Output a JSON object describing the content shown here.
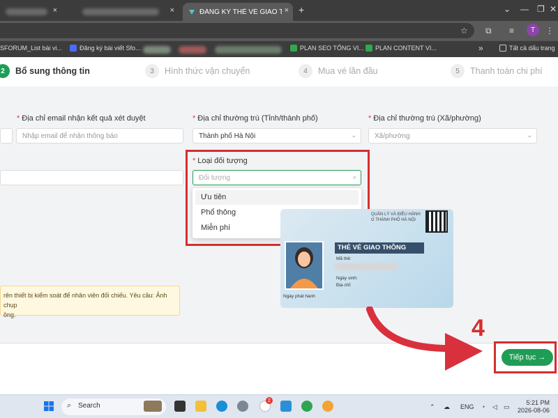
{
  "browser": {
    "active_tab_title": "ĐĂNG KÝ THẺ VÉ GIAO THÔNG",
    "tab_close": "×",
    "new_tab": "+",
    "bookmarks": [
      "SFORUM_List bài vi...",
      "Đăng ký bài viết Sfo...",
      "PLAN SEO TỔNG VI...",
      "PLAN CONTENT VI..."
    ],
    "bookmarks_overflow": "»",
    "all_bookmarks": "Tất cả dấu trang",
    "profile_initial": "T"
  },
  "steps": [
    {
      "num": "2",
      "label": "Bổ sung thông tin"
    },
    {
      "num": "3",
      "label": "Hình thức vận chuyển"
    },
    {
      "num": "4",
      "label": "Mua vé lần đầu"
    },
    {
      "num": "5",
      "label": "Thanh toán chi phí"
    }
  ],
  "form": {
    "email_label": "Địa chỉ email nhận kết quả xét duyệt",
    "email_placeholder": "Nhập email để nhận thông báo",
    "province_label": "Địa chỉ thường trú (Tỉnh/thành phố)",
    "province_value": "Thành phố Hà Nội",
    "ward_label": "Địa chỉ thường trú (Xã/phường)",
    "ward_placeholder": "Xã/phường",
    "subject_label": "Loại đối tượng",
    "subject_placeholder": "Đối tượng",
    "subject_options": [
      "Ưu tiên",
      "Phổ thông",
      "Miễn phí"
    ]
  },
  "card": {
    "org_line1": "QUẢN LÝ VÀ ĐIỀU HÀNH",
    "org_line2": "G THÀNH PHỐ HÀ NỘI",
    "title": "THẺ VÉ GIAO THÔNG",
    "ma_the": "Mã thẻ:",
    "ngay_sinh": "Ngày sinh:",
    "dia_chi": "Địa chỉ:",
    "photo_caption": "Ngày phát hành"
  },
  "note": {
    "line1": "rên thiết bị kiểm soát để nhân viên đối chiếu. Yêu cầu: Ảnh chụp",
    "line2": "ồng."
  },
  "annotation_number": "4",
  "next_button": "Tiếp tục →",
  "taskbar": {
    "search_label": "Search",
    "lang": "ENG",
    "time": "5:21 PM",
    "date": "2026-08-06",
    "badge_2": "2"
  },
  "colors": {
    "accent_green": "#1f9d55",
    "highlight_red": "#d32f2f"
  }
}
